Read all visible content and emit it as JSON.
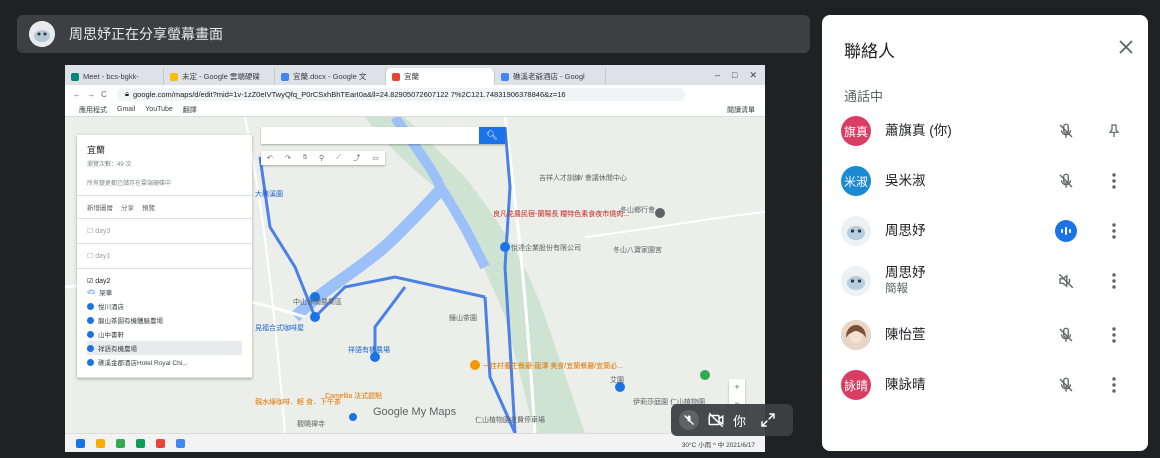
{
  "presenter": {
    "text": "周思妤正在分享螢幕畫面"
  },
  "shared_screen": {
    "tabs": [
      {
        "label": "Meet - bcs-bgkk-",
        "color": "#00897b"
      },
      {
        "label": "未定 - Google 雲端硬碟",
        "color": "#fbbc04"
      },
      {
        "label": "宜蘭.docx - Google 文",
        "color": "#4285f4"
      },
      {
        "label": "宜蘭",
        "color": "#ea4335"
      },
      {
        "label": "礁溪老爺酒店 - Googl",
        "color": "#4285f4"
      }
    ],
    "url": "google.com/maps/d/edit?mid=1v-1zZ0eIVTwyQfq_P0rCSxhBhTEarI0a&ll=24.82905072607122 7%2C121.74831906378846&z=16",
    "bookmarks": [
      "應用程式",
      "Gmail",
      "YouTube",
      "翻譯"
    ],
    "bookmarks_right": "閱讀清單",
    "map_panel": {
      "title": "宜蘭",
      "views": "瀏覽次數：49 次",
      "note": "所有變更都已儲存在雲端硬碟中",
      "actions": [
        "新增圖層",
        "分享",
        "預覽"
      ],
      "layers": [
        "day3",
        "day1"
      ],
      "open_layer": "day2",
      "base_map": "架車",
      "items": [
        "悅川酒店",
        "龍山茶園有機體驗農場",
        "山中書軒",
        "祥語有機農場",
        "礁溪金郡酒店Hotel Royal Chi..."
      ]
    },
    "map_labels": [
      "大礁溪園",
      "中山休閒農業區",
      "見福合式咖啡屋",
      "祥語有機農場",
      "一佳村養生餐廳-龍潭 美食/宜蘭餐廳/宜蘭必...",
      "Camellia 法式甜點",
      "親水綠咖啡．輕 食．下午茶",
      "觀曉禪寺",
      "悅達企業股份有限公司",
      "冬山八寶家園宮",
      "良凡花農民宿-蘭陽長 糧特色素食夜市燒肉...",
      "冬山鄉行會",
      "吉祥人才訓練/ 會議休閒中心",
      "伊莉莎庭園 仁山植物園",
      "仁山植物園收費停車場",
      "艾園",
      "鐘山茶園"
    ],
    "google_logo": "Google My Maps",
    "taskbar_right": "30°C 小雨  ^ 中  2021/6/17"
  },
  "self_view": {
    "label": "你"
  },
  "panel": {
    "title": "聯絡人",
    "section": "通話中",
    "people": [
      {
        "avatar_text": "旗真",
        "avatar_color": "#d93d63",
        "name": "蕭旗真 (你)",
        "sub": "",
        "action1": "mic-off-icon",
        "action2": "pin-icon"
      },
      {
        "avatar_text": "米淑",
        "avatar_color": "#1a8bd1",
        "name": "吳米淑",
        "sub": "",
        "action1": "mic-off-icon",
        "action2": "more-icon"
      },
      {
        "avatar_text": "",
        "avatar_color": "#e8eaed",
        "name": "周思妤",
        "sub": "",
        "action1": "speaking-icon",
        "action2": "more-icon"
      },
      {
        "avatar_text": "",
        "avatar_color": "#e8eaed",
        "name": "周思妤",
        "sub": "簡報",
        "action1": "present-off-icon",
        "action2": "more-icon"
      },
      {
        "avatar_text": "",
        "avatar_color": "#d7b7a0",
        "name": "陳怡萱",
        "sub": "",
        "action1": "mic-off-icon",
        "action2": "more-icon"
      },
      {
        "avatar_text": "詠晴",
        "avatar_color": "#d93d63",
        "name": "陳詠晴",
        "sub": "",
        "action1": "mic-off-icon",
        "action2": "more-icon"
      }
    ]
  }
}
